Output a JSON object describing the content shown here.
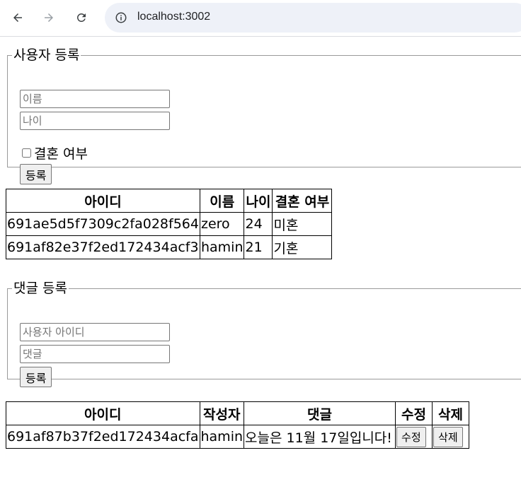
{
  "browser": {
    "url": "localhost:3002",
    "icons": {
      "back": "back-arrow-icon",
      "forward": "forward-arrow-icon",
      "reload": "reload-icon",
      "info": "info-icon"
    }
  },
  "user_form": {
    "legend": "사용자 등록",
    "name_placeholder": "이름",
    "age_placeholder": "나이",
    "married_label": "결혼 여부",
    "submit_label": "등록"
  },
  "user_table": {
    "headers": [
      "아이디",
      "이름",
      "나이",
      "결혼 여부"
    ],
    "rows": [
      [
        "691ae5d5f7309c2fa028f564",
        "zero",
        "24",
        "미혼"
      ],
      [
        "691af82e37f2ed172434acf3",
        "hamin",
        "21",
        "기혼"
      ]
    ]
  },
  "comment_form": {
    "legend": "댓글 등록",
    "user_id_placeholder": "사용자 아이디",
    "comment_placeholder": "댓글",
    "submit_label": "등록"
  },
  "comment_table": {
    "headers": [
      "아이디",
      "작성자",
      "댓글",
      "수정",
      "삭제"
    ],
    "rows": [
      {
        "id": "691af87b37f2ed172434acfa",
        "author": "hamin",
        "comment": "오늘은 11월 17일입니다!",
        "edit_label": "수정",
        "delete_label": "삭제"
      }
    ]
  }
}
